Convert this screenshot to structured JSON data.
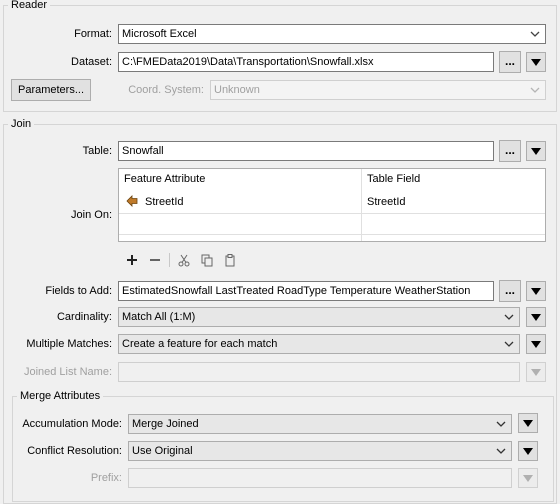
{
  "reader": {
    "legend": "Reader",
    "format_label": "Format:",
    "format_value": "Microsoft Excel",
    "dataset_label": "Dataset:",
    "dataset_value": "C:\\FMEData2019\\Data\\Transportation\\Snowfall.xlsx",
    "dots": "...",
    "parameters_label": "Parameters...",
    "coord_label": "Coord. System:",
    "coord_value": "Unknown"
  },
  "join": {
    "legend": "Join",
    "table_label": "Table:",
    "table_value": "Snowfall",
    "join_on_label": "Join On:",
    "columns": [
      "Feature Attribute",
      "Table Field"
    ],
    "rows": [
      {
        "feature_attribute": "StreetId",
        "table_field": "StreetId"
      }
    ],
    "toolbar_icons": [
      "plus-icon",
      "minus-icon",
      "cut-icon",
      "copy-icon",
      "paste-icon"
    ],
    "fields_label": "Fields to Add:",
    "fields_value": "EstimatedSnowfall LastTreated RoadType Temperature WeatherStation",
    "cardinality_label": "Cardinality:",
    "cardinality_value": "Match All (1:M)",
    "multiple_label": "Multiple Matches:",
    "multiple_value": "Create a feature for each match",
    "joined_list_label": "Joined List Name:",
    "joined_list_value": ""
  },
  "merge": {
    "legend": "Merge Attributes",
    "accum_label": "Accumulation Mode:",
    "accum_value": "Merge Joined",
    "conflict_label": "Conflict Resolution:",
    "conflict_value": "Use Original",
    "prefix_label": "Prefix:",
    "prefix_value": ""
  },
  "colors": {
    "background": "#f0f0f0",
    "attribute_icon": "#c07a2a"
  }
}
